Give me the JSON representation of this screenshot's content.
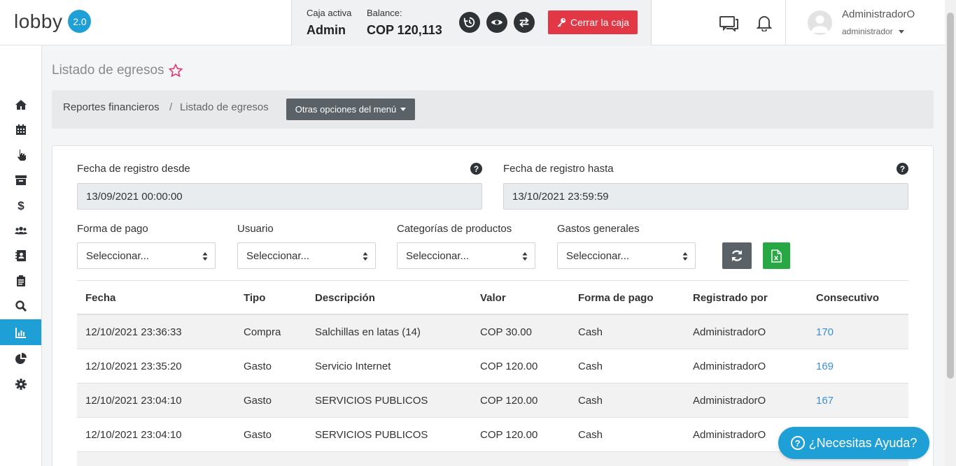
{
  "app": {
    "logo_text": "lobby",
    "version": "2.0"
  },
  "caja": {
    "active_label": "Caja activa",
    "active_value": "Admin",
    "balance_label": "Balance:",
    "balance_value": "COP 120,113",
    "close_label": "Cerrar la caja"
  },
  "user": {
    "name": "AdministradorO",
    "role": "administrador"
  },
  "page": {
    "title": "Listado de egresos"
  },
  "breadcrumb": {
    "items": [
      "Reportes financieros",
      "Listado de egresos"
    ],
    "separator": "/",
    "menu_button": "Otras opciones del menú"
  },
  "filters": {
    "date_from_label": "Fecha de registro desde",
    "date_from_value": "13/09/2021 00:00:00",
    "date_to_label": "Fecha de registro hasta",
    "date_to_value": "13/10/2021 23:59:59",
    "help_glyph": "?",
    "selects": [
      {
        "label": "Forma de pago",
        "value": "Seleccionar..."
      },
      {
        "label": "Usuario",
        "value": "Seleccionar..."
      },
      {
        "label": "Categorías de productos",
        "value": "Seleccionar..."
      },
      {
        "label": "Gastos generales",
        "value": "Seleccionar..."
      }
    ]
  },
  "table": {
    "headers": [
      "Fecha",
      "Tipo",
      "Descripción",
      "Valor",
      "Forma de pago",
      "Registrado por",
      "Consecutivo"
    ],
    "rows": [
      {
        "fecha": "12/10/2021 23:36:33",
        "tipo": "Compra",
        "descripcion": "Salchillas en latas (14)",
        "valor": "COP 30.00",
        "forma": "Cash",
        "registrado": "AdministradorO",
        "consecutivo": "170"
      },
      {
        "fecha": "12/10/2021 23:35:20",
        "tipo": "Gasto",
        "descripcion": "Servicio Internet",
        "valor": "COP 120.00",
        "forma": "Cash",
        "registrado": "AdministradorO",
        "consecutivo": "169"
      },
      {
        "fecha": "12/10/2021 23:04:10",
        "tipo": "Gasto",
        "descripcion": "SERVICIOS PUBLICOS",
        "valor": "COP 120.00",
        "forma": "Cash",
        "registrado": "AdministradorO",
        "consecutivo": "167"
      },
      {
        "fecha": "12/10/2021 23:04:10",
        "tipo": "Gasto",
        "descripcion": "SERVICIOS PUBLICOS",
        "valor": "COP 120.00",
        "forma": "Cash",
        "registrado": "AdministradorO",
        "consecutivo": ""
      }
    ]
  },
  "help_widget": {
    "label": "¿Necesitas Ayuda?",
    "glyph": "?"
  },
  "colors": {
    "accent": "#1e9fd6",
    "danger": "#e23744",
    "excel": "#28a745",
    "dark": "#2f3337"
  }
}
